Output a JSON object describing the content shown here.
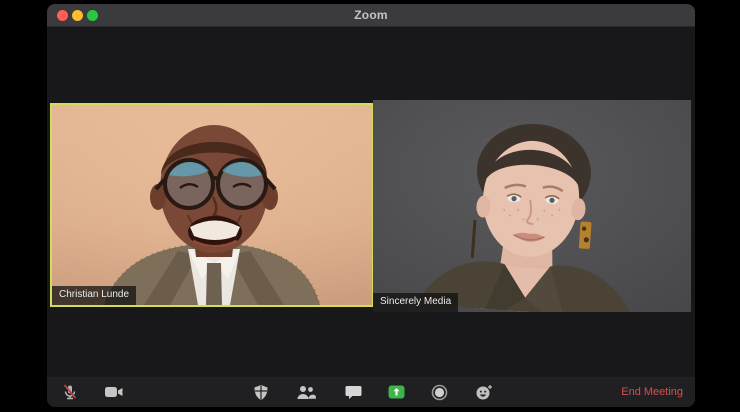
{
  "window": {
    "title": "Zoom"
  },
  "traffic_lights": {
    "close_color": "#ff5f57",
    "minimize_color": "#febc2e",
    "zoom_color": "#28c840"
  },
  "participants": [
    {
      "name": "Christian Lunde",
      "active_speaker": true
    },
    {
      "name": "Sincerely Media",
      "active_speaker": false
    }
  ],
  "toolbar": {
    "icons": [
      {
        "name": "microphone-muted-icon",
        "state": "muted"
      },
      {
        "name": "video-camera-icon",
        "state": "on"
      },
      {
        "name": "security-shield-icon"
      },
      {
        "name": "participants-icon"
      },
      {
        "name": "chat-bubble-icon"
      },
      {
        "name": "share-screen-icon",
        "accent": "#3db54a"
      },
      {
        "name": "record-icon"
      },
      {
        "name": "reactions-icon"
      }
    ],
    "end_meeting_label": "End Meeting"
  },
  "colors": {
    "active_speaker_border": "#d3dd55",
    "end_meeting_red": "#d5504e",
    "share_green": "#3db54a",
    "titlebar_bg": "#3b3b3d",
    "window_bg": "#19191b",
    "toolbar_bg": "#202023"
  }
}
